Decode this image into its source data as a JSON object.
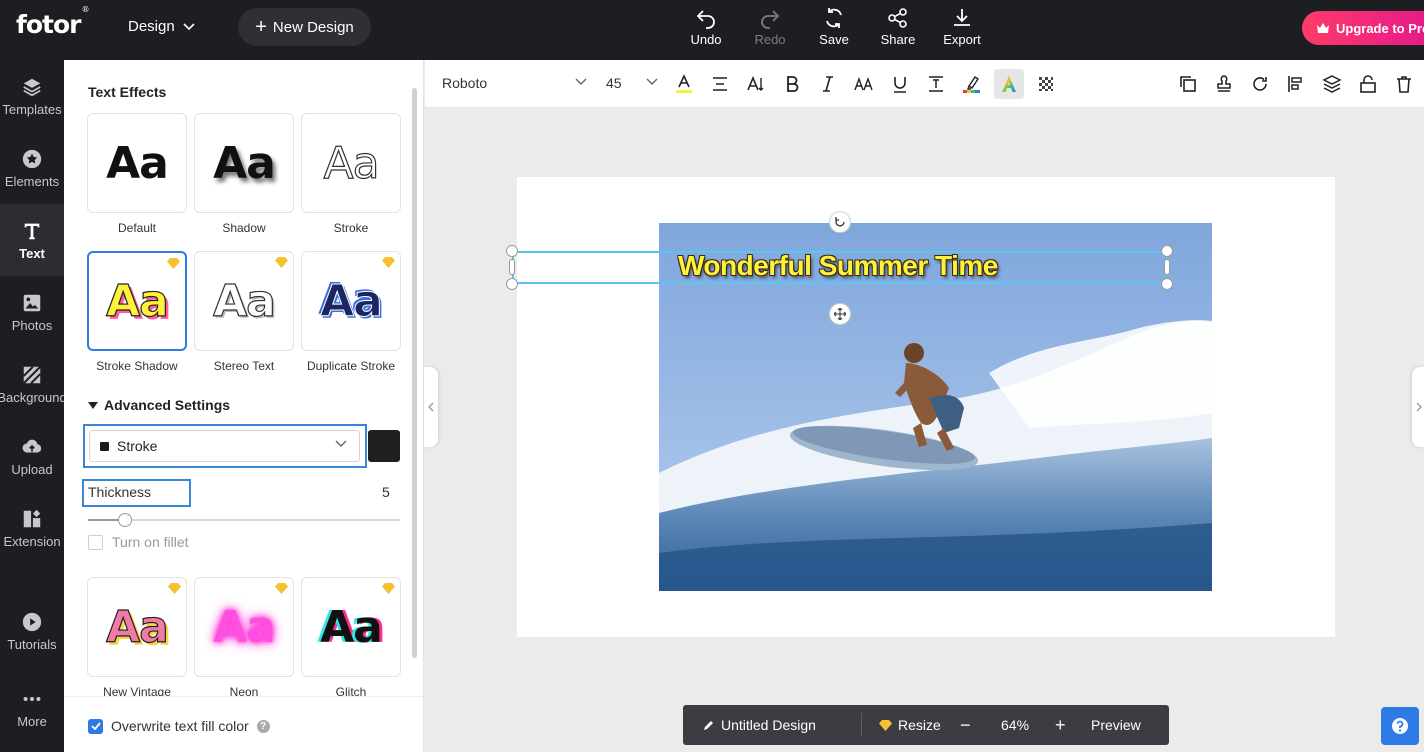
{
  "topbar": {
    "logo": "fotor",
    "logo_mark": "®",
    "design_menu": "Design",
    "new_design": "New Design",
    "actions": [
      {
        "label": "Undo",
        "icon": "undo-icon",
        "enabled": true
      },
      {
        "label": "Redo",
        "icon": "redo-icon",
        "enabled": false
      },
      {
        "label": "Save",
        "icon": "save-icon",
        "enabled": true
      },
      {
        "label": "Share",
        "icon": "share-icon",
        "enabled": true
      },
      {
        "label": "Export",
        "icon": "export-icon",
        "enabled": true
      }
    ],
    "upgrade": "Upgrade to Pro"
  },
  "leftnav": {
    "items": [
      {
        "label": "Templates",
        "icon": "templates-icon"
      },
      {
        "label": "Elements",
        "icon": "elements-icon"
      },
      {
        "label": "Text",
        "icon": "text-icon",
        "active": true
      },
      {
        "label": "Photos",
        "icon": "photos-icon"
      },
      {
        "label": "Background",
        "icon": "background-icon"
      },
      {
        "label": "Upload",
        "icon": "upload-icon"
      },
      {
        "label": "Extension",
        "icon": "extension-icon"
      },
      {
        "label": "Tutorials",
        "icon": "tutorials-icon"
      },
      {
        "label": "More",
        "icon": "more-icon"
      }
    ]
  },
  "panel": {
    "title": "Text Effects",
    "effects": [
      {
        "label": "Default",
        "sample": "Aa",
        "premium": false
      },
      {
        "label": "Shadow",
        "sample": "Aa",
        "premium": false
      },
      {
        "label": "Stroke",
        "sample": "Aa",
        "premium": false
      },
      {
        "label": "Stroke Shadow",
        "sample": "Aa",
        "premium": true,
        "selected": true
      },
      {
        "label": "Stereo Text",
        "sample": "Aa",
        "premium": true
      },
      {
        "label": "Duplicate Stroke",
        "sample": "Aa",
        "premium": true
      },
      {
        "label": "New Vintage",
        "sample": "Aa",
        "premium": true
      },
      {
        "label": "Neon",
        "sample": "Aa",
        "premium": true
      },
      {
        "label": "Glitch",
        "sample": "Aa",
        "premium": true
      }
    ],
    "advanced": {
      "title": "Advanced Settings",
      "mode": "Stroke",
      "color": "#1f1f1f",
      "thickness_label": "Thickness",
      "thickness_value": "5",
      "fillet_label": "Turn on fillet",
      "fillet_checked": false
    },
    "overwrite_label": "Overwrite text fill color",
    "overwrite_checked": true
  },
  "toolbar": {
    "font": "Roboto",
    "size": "45"
  },
  "canvas": {
    "headline": "Wonderful Summer Time",
    "headline_color": "#fff23a"
  },
  "bottombar": {
    "name": "Untitled Design",
    "resize": "Resize",
    "zoom": "64%",
    "preview": "Preview"
  },
  "colors": {
    "accent": "#2f7be6",
    "topbar_bg": "#1d1e22",
    "upgrade_gradient": [
      "#ff3b6a",
      "#e2178c"
    ]
  }
}
